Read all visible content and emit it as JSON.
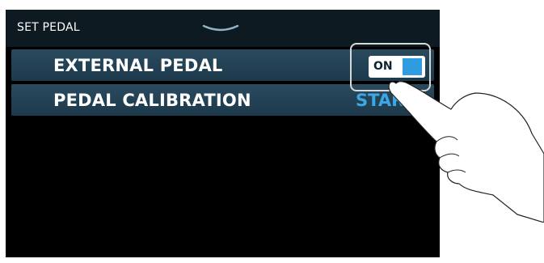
{
  "header": {
    "title": "SET PEDAL"
  },
  "settings": [
    {
      "label": "EXTERNAL PEDAL",
      "control": "toggle",
      "value": "ON",
      "on": true
    },
    {
      "label": "PEDAL CALIBRATION",
      "control": "button",
      "value": "START"
    }
  ],
  "colors": {
    "accent": "#2f9be0",
    "row_bg": "#234457",
    "screen_bg": "#000000"
  },
  "icons": {
    "collapse": "chevron-down-icon",
    "pointer": "pointing-hand-icon"
  }
}
